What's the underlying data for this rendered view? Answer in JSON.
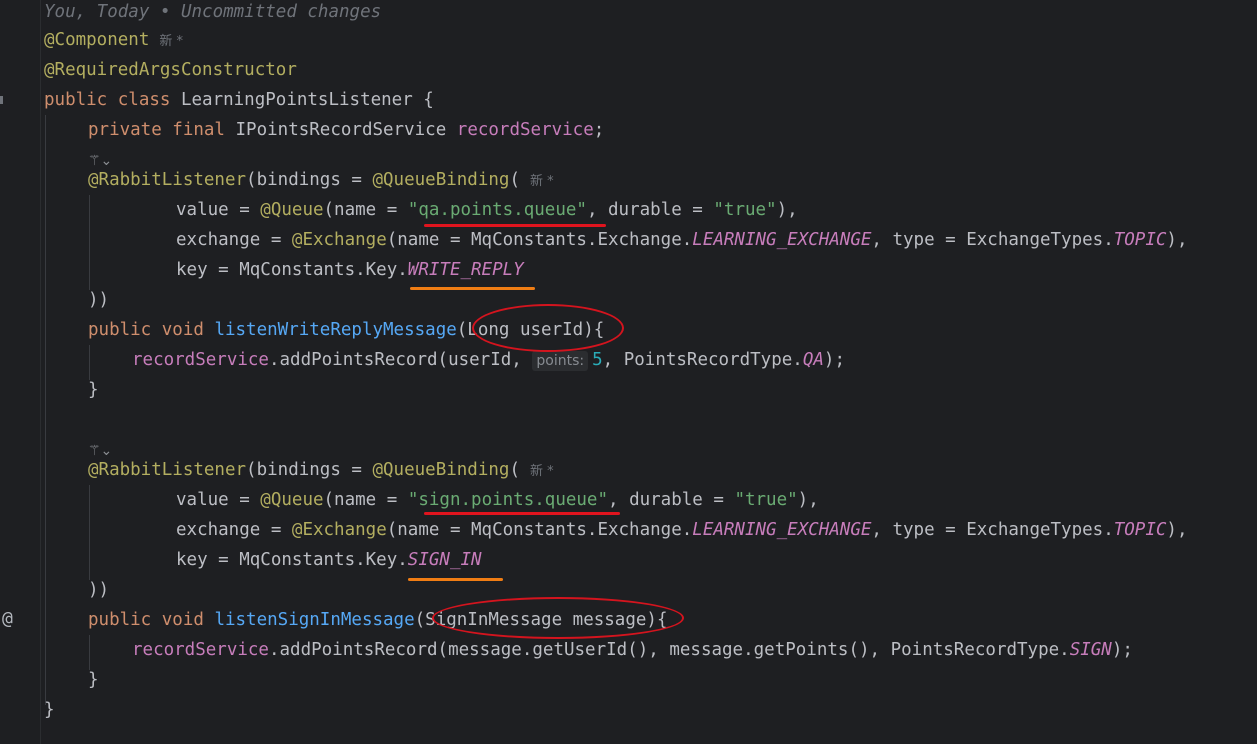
{
  "blame": "You, Today • Uncommitted changes",
  "hint_new": "新 *",
  "param_hint": "points:",
  "code": {
    "component": "@Component",
    "required_args": "@RequiredArgsConstructor",
    "class_kw": "public class ",
    "class_name": "LearningPointsListener",
    "brace_open": " {",
    "field_mod": "private final ",
    "field_type": "IPointsRecordService ",
    "field_name": "recordService",
    "semicolon": ";",
    "rabbit_listener": "@RabbitListener",
    "bindings_eq": "(bindings = ",
    "queue_binding": "@QueueBinding",
    "paren_open": "(",
    "value_eq": "value = ",
    "queue_ann": "@Queue",
    "name_eq": "(name = ",
    "qa_queue": "\"qa.points.queue\"",
    "sign_queue": "\"sign.points.queue\"",
    "durable_eq": ", durable = ",
    "true_str": "\"true\"",
    "close_paren_comma": "),",
    "exchange_eq": "exchange = ",
    "exchange_ann": "@Exchange",
    "mq_exchange": "(name = MqConstants.Exchange.",
    "learning_exchange": "LEARNING_EXCHANGE",
    "type_eq": ", type = ExchangeTypes.",
    "topic": "TOPIC",
    "key_eq": "key = MqConstants.Key.",
    "write_reply": "WRITE_REPLY",
    "sign_in": "SIGN_IN",
    "close_binding": "))",
    "method_mod": "public void ",
    "listen_write": "listenWriteReplyMessage",
    "write_params": "(Long userId)",
    "listen_sign": "listenSignInMessage",
    "sign_params": "(SignInMessage message)",
    "record_service": "recordService",
    "add_points_qa": ".addPointsRecord(userId, ",
    "five": "5",
    "record_type_qa": ", PointsRecordType.",
    "qa": "QA",
    "add_points_sign": ".addPointsRecord(message.getUserId(), message.getPoints(), PointsRecordType.",
    "sign": "SIGN",
    "end_call": ");",
    "brace_close": "}",
    "at_sign": "@"
  },
  "colors": {
    "background": "#1e1f22",
    "keyword": "#cf8e6d",
    "annotation": "#b3ae60",
    "string": "#6aab73",
    "field": "#c77dbb",
    "method": "#56a8f5",
    "number": "#2aacb8",
    "markup_red": "#e0141e",
    "markup_orange": "#f07d14"
  }
}
